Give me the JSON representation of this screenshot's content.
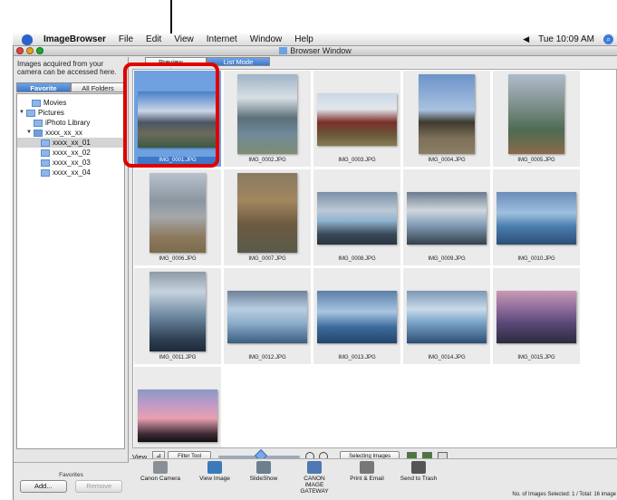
{
  "menubar": {
    "app_name": "ImageBrowser",
    "items": [
      "File",
      "Edit",
      "View",
      "Internet",
      "Window",
      "Help"
    ],
    "clock": "Tue 10:09 AM"
  },
  "window": {
    "title": "Browser Window"
  },
  "left_panel": {
    "hint": "Images acquired from your camera can be accessed here.",
    "tab_favorites": "Favorite Folders",
    "tab_all": "All Folders",
    "tree": [
      "Movies",
      "Pictures",
      "iPhoto Library",
      "xxxx_xx_xx",
      "xxxx_xx_01",
      "xxxx_xx_02",
      "xxxx_xx_03",
      "xxxx_xx_04"
    ],
    "favorites_label": "Favorites",
    "add_label": "Add...",
    "remove_label": "Remove"
  },
  "main": {
    "tab_preview": "Preview Mode",
    "tab_list": "List Mode",
    "images": [
      "IMG_0001.JPG",
      "IMG_0002.JPG",
      "IMG_0003.JPG",
      "IMG_0004.JPG",
      "IMG_0005.JPG",
      "IMG_0006.JPG",
      "IMG_0007.JPG",
      "IMG_0008.JPG",
      "IMG_0009.JPG",
      "IMG_0010.JPG",
      "IMG_0011.JPG",
      "IMG_0012.JPG",
      "IMG_0013.JPG",
      "IMG_0014.JPG",
      "IMG_0015.JPG",
      ""
    ]
  },
  "toolbar": {
    "view_label": "View",
    "filter_label": "Filter Tool",
    "selecting_label": "Selecting Images"
  },
  "actions": {
    "canon_camera": "Canon Camera",
    "view_image": "View Image",
    "slideshow": "SlideShow",
    "gateway_line1": "CANON iMAGE",
    "gateway_line2": "GATEWAY",
    "print_email": "Print & Email",
    "send_trash": "Send to Trash"
  },
  "status": "No. of Images Selected: 1 / Total: 16 image"
}
